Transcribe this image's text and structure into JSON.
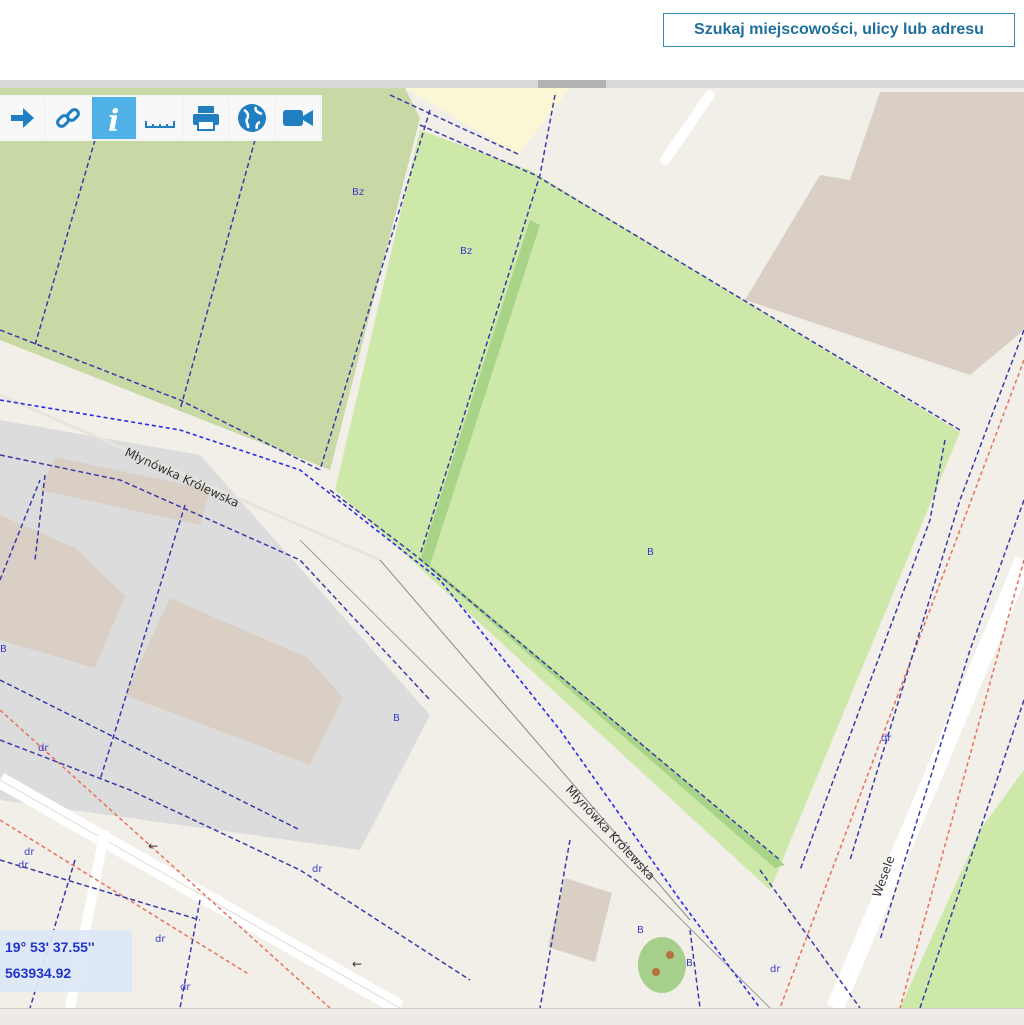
{
  "search": {
    "label": "Szukaj miejscowości, ulicy lub adresu"
  },
  "toolbar": {
    "tools": [
      {
        "name": "forward",
        "icon": "arrow-right-icon"
      },
      {
        "name": "link",
        "icon": "link-icon"
      },
      {
        "name": "info",
        "icon": "info-icon",
        "active": true
      },
      {
        "name": "measure",
        "icon": "ruler-icon"
      },
      {
        "name": "print",
        "icon": "printer-icon"
      },
      {
        "name": "globe",
        "icon": "globe-icon"
      },
      {
        "name": "video",
        "icon": "video-camera-icon"
      }
    ]
  },
  "map": {
    "streets": [
      "Młynówka Królewska",
      "Młynówka Królewska",
      "Wesele"
    ],
    "land_labels": [
      "Bz",
      "Bz",
      "B",
      "B",
      "B",
      "B",
      "B",
      "dr",
      "dr",
      "dr",
      "dr",
      "dr",
      "dr",
      "dr",
      "dr"
    ]
  },
  "coords": {
    "lon": "19° 53' 37.55''",
    "y": "563934.92"
  },
  "colors": {
    "accent": "#4fb1e6",
    "parcel_line": "#3c3cc8",
    "grass": "#cde8a9",
    "orchard": "#c8d9a6",
    "building": "#d9cfc4"
  }
}
